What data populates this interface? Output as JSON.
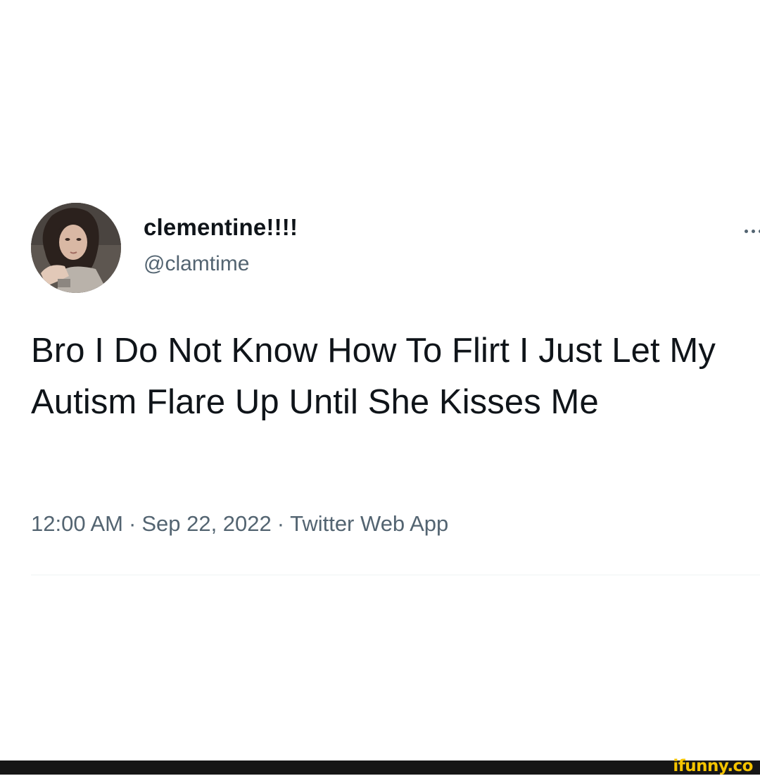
{
  "tweet": {
    "author": {
      "display_name": "clementine!!!!",
      "handle": "@clamtime",
      "avatar": "profile-photo"
    },
    "more_icon": "more-horizontal-icon",
    "text": "Bro I Do Not Know How To Flirt I Just Let My Autism Flare Up Until She Kisses Me",
    "time": "12:00 AM",
    "separator": "·",
    "date": "Sep 22, 2022",
    "source": "Twitter Web App"
  },
  "watermark": {
    "text": "ifunny.co",
    "color": "#f5c400",
    "bar_color": "#161616"
  },
  "colors": {
    "background": "#ffffff",
    "text_primary": "#0f1419",
    "text_secondary": "#536471",
    "divider": "#eff3f4"
  }
}
